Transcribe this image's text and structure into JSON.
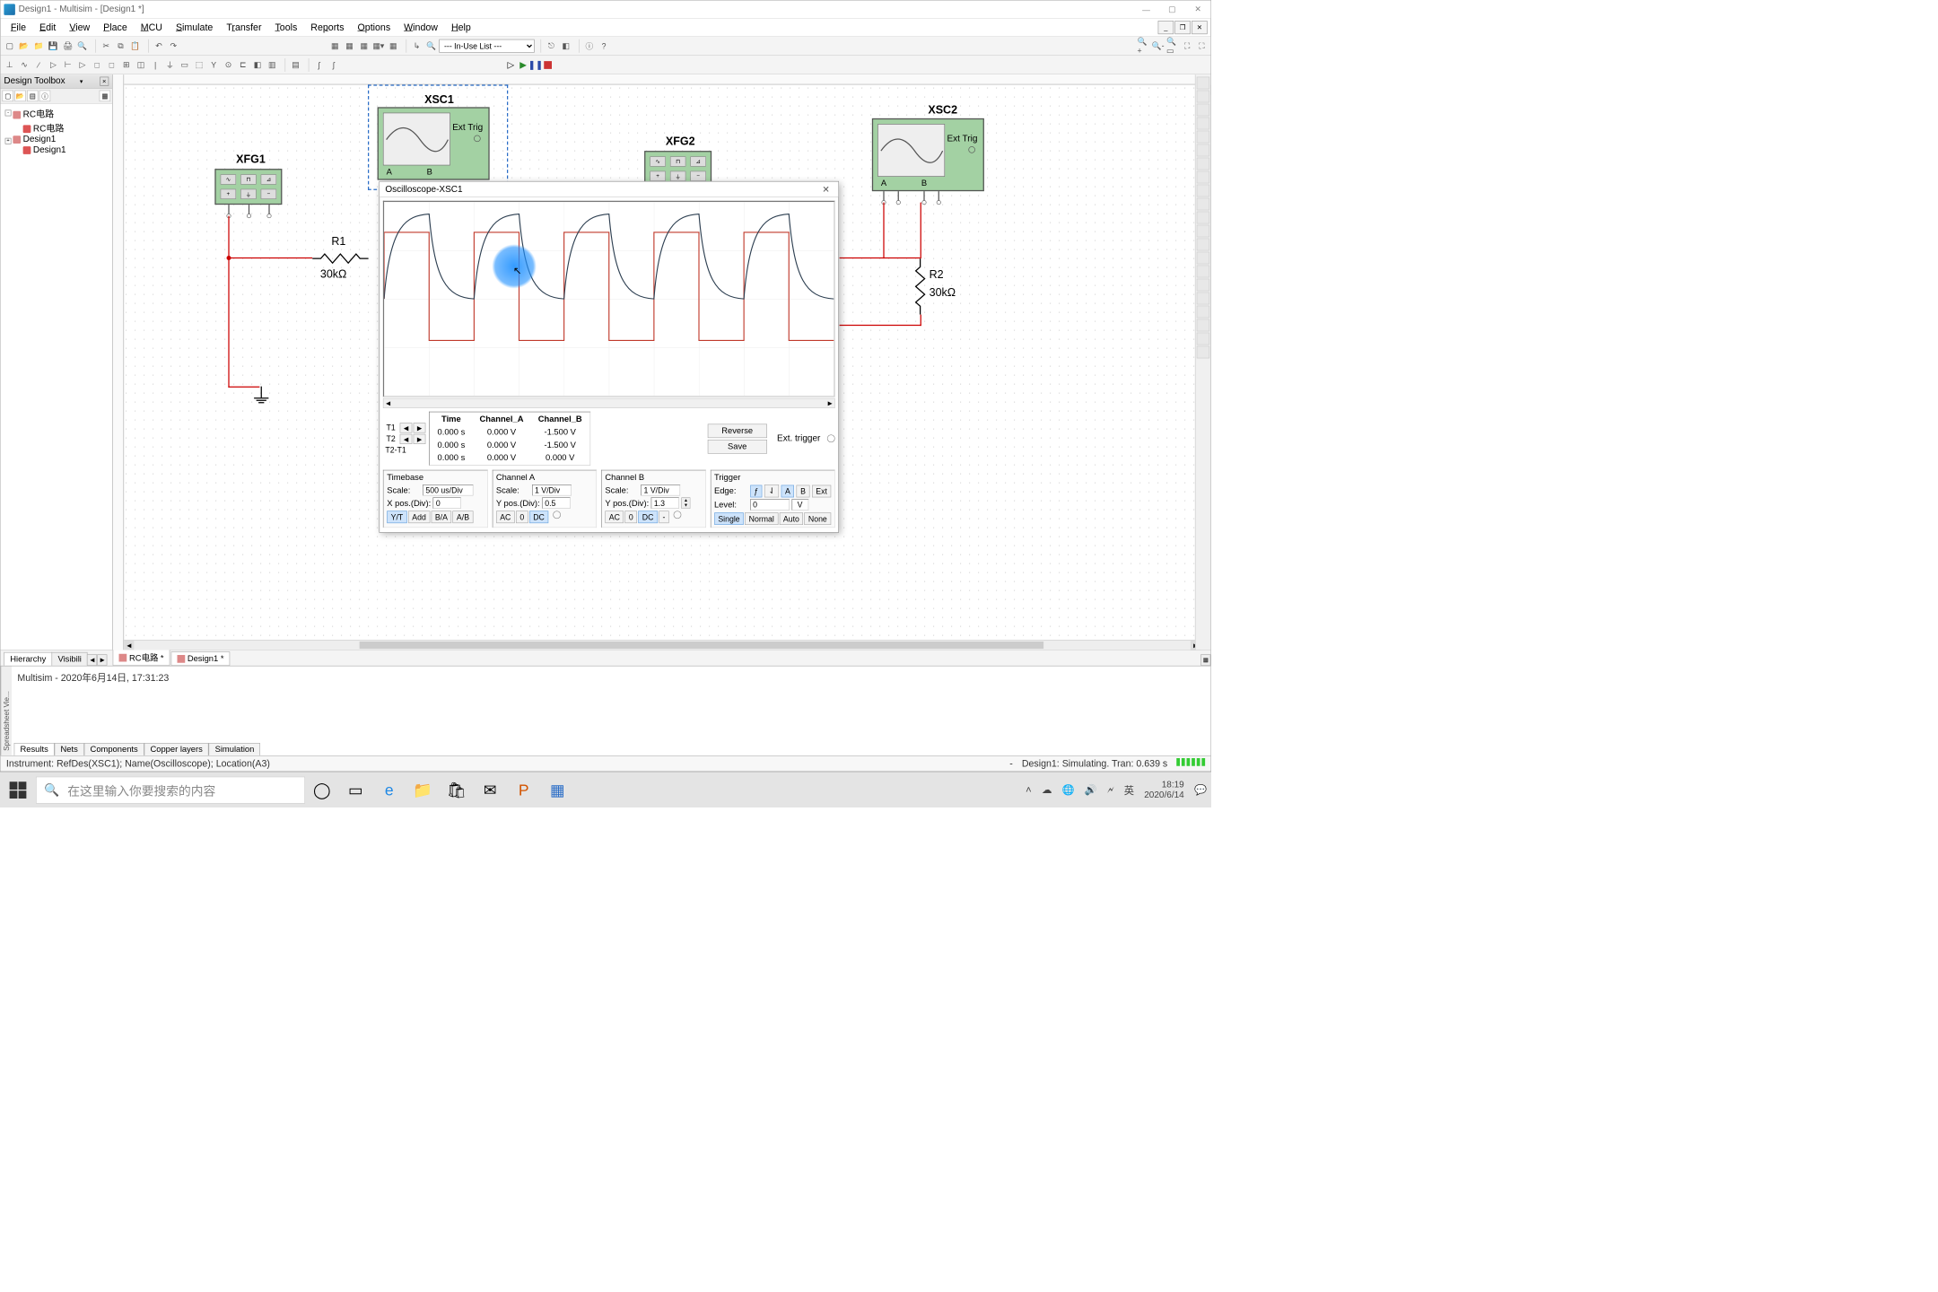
{
  "window": {
    "title": "Design1 - Multisim - [Design1 *]"
  },
  "menu": [
    "File",
    "Edit",
    "View",
    "Place",
    "MCU",
    "Simulate",
    "Transfer",
    "Tools",
    "Reports",
    "Options",
    "Window",
    "Help"
  ],
  "toolbar": {
    "inuse_list": "--- In-Use List ---"
  },
  "toolbox": {
    "title": "Design Toolbox",
    "nodes": {
      "rc_root": "RC电路",
      "rc_child": "RC电路",
      "design1_root": "Design1",
      "design1_child": "Design1"
    }
  },
  "tabs": {
    "view_hierarchy": "Hierarchy",
    "view_visibility": "Visibili",
    "doc_rc": "RC电路 *",
    "doc_design1": "Design1 *"
  },
  "canvas": {
    "xfg1": "XFG1",
    "xfg2": "XFG2",
    "xsc1": "XSC1",
    "xsc2": "XSC2",
    "ext_trig": "Ext Trig",
    "r1_name": "R1",
    "r1_val": "30kΩ",
    "r2_name": "R2",
    "r2_val": "30kΩ",
    "scope_a": "A",
    "scope_b": "B"
  },
  "osc": {
    "title": "Oscilloscope-XSC1",
    "reverse": "Reverse",
    "save": "Save",
    "ext_trig": "Ext. trigger",
    "time_h": "Time",
    "cha_h": "Channel_A",
    "chb_h": "Channel_B",
    "t1_label": "T1",
    "t2_label": "T2",
    "t21_label": "T2-T1",
    "t1_time": "0.000 s",
    "t2_time": "0.000 s",
    "dt_time": "0.000 s",
    "t1_a": "0.000 V",
    "t2_a": "0.000 V",
    "dt_a": "0.000 V",
    "t1_b": "-1.500 V",
    "t2_b": "-1.500 V",
    "dt_b": "0.000 V",
    "timebase": {
      "title": "Timebase",
      "scale_l": "Scale:",
      "scale_v": "500 us/Div",
      "xpos_l": "X pos.(Div):",
      "xpos_v": "0",
      "yt": "Y/T",
      "add": "Add",
      "ba": "B/A",
      "ab": "A/B"
    },
    "cha": {
      "title": "Channel A",
      "scale_l": "Scale:",
      "scale_v": "1 V/Div",
      "ypos_l": "Y pos.(Div):",
      "ypos_v": "0.5",
      "ac": "AC",
      "zero": "0",
      "dc": "DC"
    },
    "chb": {
      "title": "Channel B",
      "scale_l": "Scale:",
      "scale_v": "1 V/Div",
      "ypos_l": "Y pos.(Div):",
      "ypos_v": "1.3",
      "ac": "AC",
      "zero": "0",
      "dc": "DC",
      "minus": "-"
    },
    "trig": {
      "title": "Trigger",
      "edge_l": "Edge:",
      "a": "A",
      "b": "B",
      "ext": "Ext",
      "level_l": "Level:",
      "level_v": "0",
      "level_u": "V",
      "single": "Single",
      "normal": "Normal",
      "auto": "Auto",
      "none": "None"
    }
  },
  "spreadsheet": {
    "vtab": "Spreadsheet Vie...",
    "line": "Multisim  -  2020年6月14日, 17:31:23",
    "tabs": [
      "Results",
      "Nets",
      "Components",
      "Copper layers",
      "Simulation"
    ]
  },
  "status": {
    "left": "Instrument: RefDes(XSC1); Name(Oscilloscope); Location(A3)",
    "center": "-",
    "right": "Design1: Simulating. Tran: 0.639 s"
  },
  "taskbar": {
    "search_placeholder": "在这里输入你要搜索的内容",
    "ime": "英",
    "time": "18:19",
    "date": "2020/6/14"
  },
  "chart_data": {
    "type": "line",
    "description": "Oscilloscope XSC1 display showing 5 periods of a square wave (Channel A, red) and the resulting RC charge/discharge response (Channel B, blue) on a 30kΩ RC circuit.",
    "timebase_per_div_us": 500,
    "volts_per_div": 1,
    "channel_a": {
      "waveform": "square",
      "amplitude_v": 1.5,
      "period_us": 1000,
      "offset_div": 0.5,
      "color": "#c0392b"
    },
    "channel_b": {
      "waveform": "rc_exponential",
      "amplitude_v": 1.5,
      "period_us": 1000,
      "offset_div": 1.3,
      "color": "#34495e"
    }
  }
}
